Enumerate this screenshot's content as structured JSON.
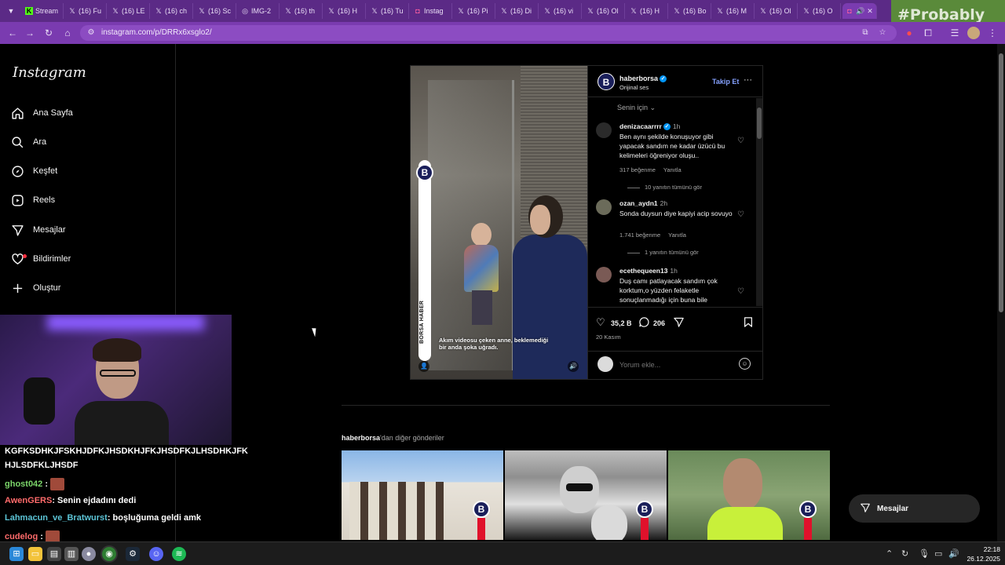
{
  "browser": {
    "tabs": [
      {
        "label": "Stream",
        "icon": "kick-icon",
        "color": "#53fc18"
      },
      {
        "label": "(16) Fu",
        "icon": "x-icon"
      },
      {
        "label": "(16) LE",
        "icon": "x-icon"
      },
      {
        "label": "(16) ch",
        "icon": "x-icon"
      },
      {
        "label": "(16) Sc",
        "icon": "x-icon"
      },
      {
        "label": "IMG-2",
        "icon": "globe-icon"
      },
      {
        "label": "(16) th",
        "icon": "x-icon"
      },
      {
        "label": "(16) H",
        "icon": "x-icon"
      },
      {
        "label": "(16) Tu",
        "icon": "x-icon"
      },
      {
        "label": "Instag",
        "icon": "instagram-icon"
      },
      {
        "label": "(16) Pi",
        "icon": "x-icon"
      },
      {
        "label": "(16) Di",
        "icon": "x-icon"
      },
      {
        "label": "(16) vi",
        "icon": "x-icon"
      },
      {
        "label": "(16) Ol",
        "icon": "x-icon"
      },
      {
        "label": "(16) H",
        "icon": "x-icon"
      },
      {
        "label": "(16) Bo",
        "icon": "x-icon"
      },
      {
        "label": "(16) M",
        "icon": "x-icon"
      },
      {
        "label": "(16) Ol",
        "icon": "x-icon"
      },
      {
        "label": "(16) O",
        "icon": "x-icon"
      }
    ],
    "active_tab": {
      "icon": "instagram-icon",
      "audio_icon": "speaker-icon",
      "close": "✕"
    },
    "url": "instagram.com/p/DRRx6xsglo2/",
    "overlay_brand": "#Probably",
    "accent": "#7a3bb0"
  },
  "sidebar": {
    "logo": "Instagram",
    "items": [
      {
        "label": "Ana Sayfa",
        "icon": "home-icon"
      },
      {
        "label": "Ara",
        "icon": "search-icon"
      },
      {
        "label": "Keşfet",
        "icon": "compass-icon"
      },
      {
        "label": "Reels",
        "icon": "reels-icon"
      },
      {
        "label": "Mesajlar",
        "icon": "send-icon"
      },
      {
        "label": "Bildirimler",
        "icon": "heart-icon"
      },
      {
        "label": "Oluştur",
        "icon": "plus-icon"
      }
    ]
  },
  "post": {
    "media": {
      "strip_text": "BORSA HABER",
      "badge": "B",
      "caption": "Akım videosu çeken anne, beklemediği bir anda şoka uğradı."
    },
    "header": {
      "username": "haberborsa",
      "subtitle": "Orijinal ses",
      "follow": "Takip Et",
      "more": "···"
    },
    "sort_label": "Senin için ⌄",
    "comments": [
      {
        "user": "denizacaarrrr",
        "verified": true,
        "time": "1h",
        "text": "Ben aynı şekilde konuşuyor gibi yapacak sandım ne kadar üzücü bu kelimeleri öğreniyor oluşu..",
        "likes": "317 beğenme",
        "reply": "Yanıtla",
        "replies": "10 yanıtın tümünü gör"
      },
      {
        "user": "ozan_aydn1",
        "verified": false,
        "time": "2h",
        "text": "Sonda duysun diye kapiyi acip sovuyo",
        "likes": "1.741 beğenme",
        "reply": "Yanıtla",
        "replies": "1 yanıtın tümünü gör"
      },
      {
        "user": "ecethequeen13",
        "verified": false,
        "time": "1h",
        "text": "Duş camı patlayacak sandım çok korktum,o yüzden felaketle sonuçlanmadığı için buna bile",
        "likes": "",
        "reply": "",
        "replies": ""
      }
    ],
    "likes": "35,2 B",
    "comments_count": "206",
    "date": "20 Kasım",
    "comment_placeholder": "Yorum ekle..."
  },
  "more_posts": {
    "username": "haberborsa",
    "suffix": "'dan diğer gönderiler",
    "badge": "B"
  },
  "messages_pill": "Mesajlar",
  "chat": [
    {
      "user": "",
      "text": "KGFKSDHKJFSKHJDFKJHSDKHJFKJHSDFKJLHSDHKJFK",
      "color": "#ffffff"
    },
    {
      "user": "",
      "text": "HJLSDFKLJHSDF",
      "color": "#ffffff"
    },
    {
      "user": "ghost042",
      "text": ":",
      "color": "#7cd66a"
    },
    {
      "user": "AwenGERS",
      "text": ": Senin ejdadını dedi",
      "color": "#ff6b6b"
    },
    {
      "user": "Lahmacun_ve_Bratwurst",
      "text": ": boşluğuma geldi amk",
      "color": "#5cc4d6"
    },
    {
      "user": "cudelog",
      "text": ":",
      "color": "#ff6b6b"
    }
  ],
  "taskbar": {
    "time": "22:18",
    "date": "26.12.2025"
  }
}
